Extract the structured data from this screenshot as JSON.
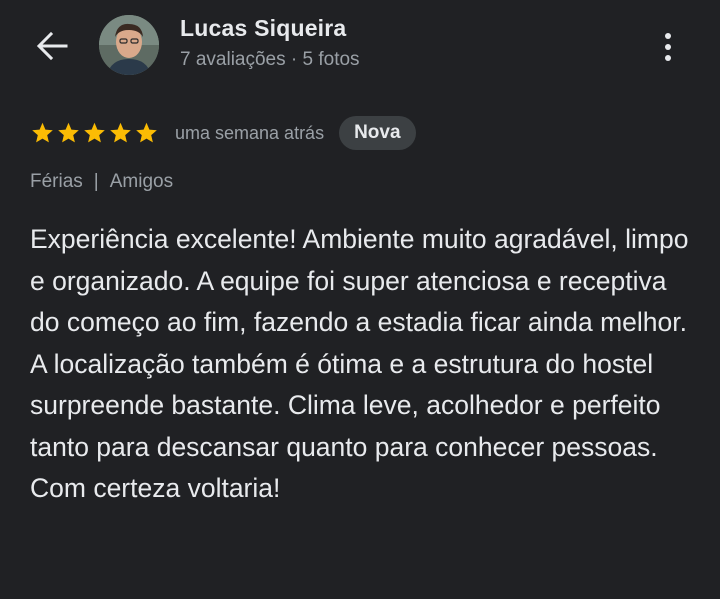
{
  "user": {
    "name": "Lucas Siqueira",
    "reviews_count": "7 avaliações",
    "separator": "·",
    "photos_count": "5 fotos"
  },
  "review": {
    "rating": 5,
    "rating_max": 5,
    "date": "uma semana atrás",
    "badge": "Nova",
    "tags": [
      "Férias",
      "Amigos"
    ],
    "tag_separator": "|",
    "text": "Experiência excelente! Ambiente muito agradável, limpo e organizado. A equipe foi super atenciosa e receptiva do começo ao fim, fazendo a estadia ficar ainda melhor. A localização também é ótima e a estrutura do hostel surpreende bastante. Clima leve, acolhedor e perfeito tanto para descansar quanto para conhecer pessoas. Com certeza voltaria!"
  },
  "colors": {
    "background": "#202124",
    "star": "#fbbc04",
    "badge_bg": "#3c4043",
    "text_primary": "#e8eaed",
    "text_secondary": "#9aa0a6"
  },
  "icons": {
    "back": "arrow-back-icon",
    "more": "more-vert-icon",
    "star": "star-icon"
  }
}
